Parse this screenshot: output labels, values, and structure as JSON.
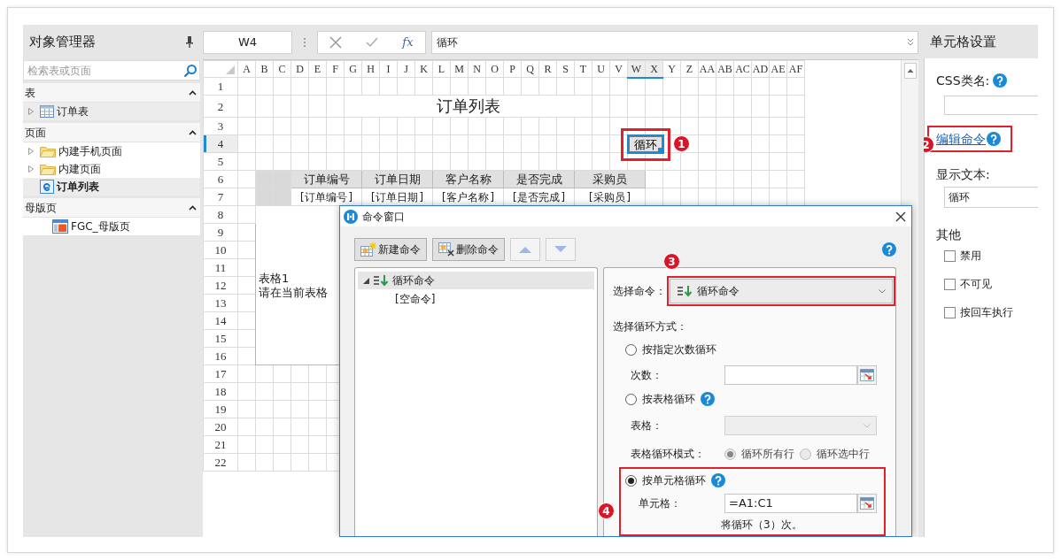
{
  "object_manager": {
    "title": "对象管理器",
    "search": {
      "placeholder": "检索表或页面"
    },
    "sections": [
      {
        "title": "表",
        "expanded": true,
        "items": [
          {
            "label": "订单表",
            "kind": "table",
            "expandable": true,
            "selected": true,
            "current": false
          }
        ]
      },
      {
        "title": "页面",
        "expanded": true,
        "items": [
          {
            "label": "内建手机页面",
            "kind": "folder",
            "expandable": true,
            "selected": false,
            "current": false
          },
          {
            "label": "内建页面",
            "kind": "folder",
            "expandable": true,
            "selected": false,
            "current": false
          },
          {
            "label": "订单列表",
            "kind": "page",
            "expandable": false,
            "selected": true,
            "current": true
          }
        ]
      },
      {
        "title": "母版页",
        "expanded": true,
        "items": [
          {
            "label": "FGC_母版页",
            "kind": "master",
            "expandable": false,
            "selected": false,
            "current": false
          }
        ]
      }
    ]
  },
  "formula_bar": {
    "cell_name": "W4",
    "function_label": "fx",
    "formula": "循环"
  },
  "sheet": {
    "columns": [
      {
        "label": "A",
        "selected": false
      },
      {
        "label": "B",
        "selected": false
      },
      {
        "label": "C",
        "selected": false
      },
      {
        "label": "D",
        "selected": false
      },
      {
        "label": "E",
        "selected": false
      },
      {
        "label": "F",
        "selected": false
      },
      {
        "label": "G",
        "selected": false
      },
      {
        "label": "H",
        "selected": false
      },
      {
        "label": "I",
        "selected": false
      },
      {
        "label": "J",
        "selected": false
      },
      {
        "label": "K",
        "selected": false
      },
      {
        "label": "L",
        "selected": false
      },
      {
        "label": "M",
        "selected": false
      },
      {
        "label": "N",
        "selected": false
      },
      {
        "label": "O",
        "selected": false
      },
      {
        "label": "P",
        "selected": false
      },
      {
        "label": "Q",
        "selected": false
      },
      {
        "label": "R",
        "selected": false
      },
      {
        "label": "S",
        "selected": false
      },
      {
        "label": "T",
        "selected": false
      },
      {
        "label": "U",
        "selected": false
      },
      {
        "label": "V",
        "selected": false
      },
      {
        "label": "W",
        "selected": true
      },
      {
        "label": "X",
        "selected": true
      },
      {
        "label": "Y",
        "selected": false
      },
      {
        "label": "Z",
        "selected": false
      },
      {
        "label": "AA",
        "selected": false
      },
      {
        "label": "AB",
        "selected": false
      },
      {
        "label": "AC",
        "selected": false
      },
      {
        "label": "AD",
        "selected": false
      },
      {
        "label": "AE",
        "selected": false
      },
      {
        "label": "AF",
        "selected": false
      }
    ],
    "rows": [
      {
        "label": "1",
        "selected": false
      },
      {
        "label": "2",
        "selected": false
      },
      {
        "label": "3",
        "selected": false
      },
      {
        "label": "4",
        "selected": true
      },
      {
        "label": "5",
        "selected": false
      },
      {
        "label": "6",
        "selected": false
      },
      {
        "label": "7",
        "selected": false
      },
      {
        "label": "8",
        "selected": false
      },
      {
        "label": "9",
        "selected": false
      },
      {
        "label": "10",
        "selected": false
      },
      {
        "label": "11",
        "selected": false
      },
      {
        "label": "12",
        "selected": false
      },
      {
        "label": "13",
        "selected": false
      },
      {
        "label": "14",
        "selected": false
      },
      {
        "label": "15",
        "selected": false
      },
      {
        "label": "16",
        "selected": false
      },
      {
        "label": "17",
        "selected": false
      },
      {
        "label": "18",
        "selected": false
      },
      {
        "label": "19",
        "selected": false
      },
      {
        "label": "20",
        "selected": false
      },
      {
        "label": "21",
        "selected": false
      },
      {
        "label": "22",
        "selected": false
      }
    ],
    "title": "订单列表",
    "button": {
      "text": "循环",
      "badge": "1"
    },
    "headers": [
      "订单编号",
      "订单日期",
      "客户名称",
      "是否完成",
      "采购员"
    ],
    "fields": [
      "[订单编号]",
      "[订单日期]",
      "[客户名称]",
      "[是否完成]",
      "[采购员]"
    ],
    "table_caption": "表格1",
    "table_hint": "请在当前表格"
  },
  "dialog": {
    "title": "命令窗口",
    "toolbar": [
      {
        "label": "新建命令",
        "kind": "new",
        "disabled": false
      },
      {
        "label": "删除命令",
        "kind": "delete",
        "disabled": false
      },
      {
        "kind": "up",
        "disabled": true
      },
      {
        "kind": "down",
        "disabled": true
      }
    ],
    "tree": [
      {
        "label": "循环命令",
        "expanded": true,
        "selected": true,
        "children": [
          {
            "label": "[空命令]",
            "selected": false
          }
        ]
      }
    ],
    "command_label": "选择命令：",
    "command": "循环命令",
    "command_badge": "3",
    "mode_label": "选择循环方式：",
    "count_mode": {
      "label": "按指定次数循环",
      "selected": false,
      "field_label": "次数："
    },
    "table_mode": {
      "label": "按表格循环",
      "selected": false,
      "field_label": "表格：",
      "field_disabled": true,
      "option_label": "表格循环模式：",
      "options": [
        {
          "label": "循环所有行",
          "selected": true,
          "disabled": true
        },
        {
          "label": "循环选中行",
          "selected": false,
          "disabled": true
        }
      ]
    },
    "cell_mode": {
      "label": "按单元格循环",
      "selected": true,
      "field_label": "单元格：",
      "value": "=A1:C1",
      "note": "将循环（3）次。",
      "badge": "4"
    }
  },
  "cell_settings": {
    "title": "单元格设置",
    "css_label": "CSS类名:",
    "edit_command": "编辑命令",
    "edit_badge": "2",
    "display_label": "显示文本:",
    "display_value": "循环",
    "other_label": "其他",
    "options": [
      {
        "label": "禁用",
        "checked": false
      },
      {
        "label": "不可见",
        "checked": false
      },
      {
        "label": "按回车执行",
        "checked": false
      }
    ]
  }
}
